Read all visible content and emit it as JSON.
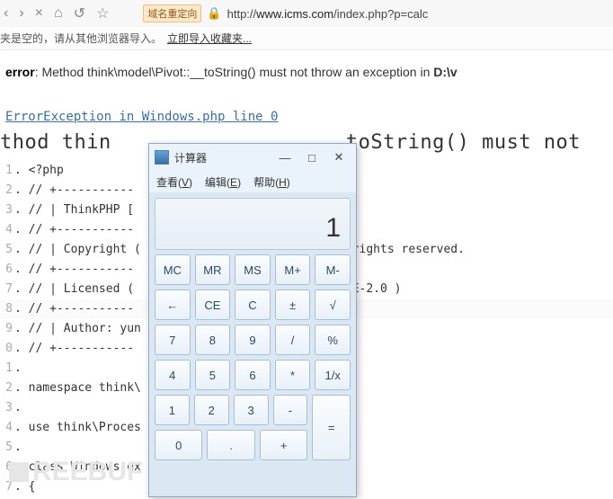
{
  "toolbar": {
    "redirect_label": "域名重定向",
    "url_prefix": "http://",
    "url_host": "www.icms.com",
    "url_path": "/index.php?p=calc"
  },
  "bookmark_bar": {
    "empty_msg": "夹是空的，请从其他浏览器导入。",
    "import_link": "立即导入收藏夹..."
  },
  "page": {
    "fatal_prefix": "error",
    "fatal_msg": ": Method think\\model\\Pivot::__toString() must not throw an exception in ",
    "fatal_path": "D:\\v",
    "exc_link": "ErrorException in Windows.php line 0",
    "big_left": "thod thin",
    "big_right": "toString() must not",
    "code_lines": [
      {
        "n": "1",
        "t": "<?php"
      },
      {
        "n": "2",
        "t": "// +-----------"
      },
      {
        "n": "3",
        "t": "// | ThinkPHP ["
      },
      {
        "n": "4",
        "t": "// +-----------"
      },
      {
        "n": "5",
        "t": "// | Copyright ("
      },
      {
        "n": "5r",
        "t": " rights reserved."
      },
      {
        "n": "6",
        "t": "// +-----------"
      },
      {
        "n": "7",
        "t": "// | Licensed ("
      },
      {
        "n": "7r",
        "t": "NSE-2.0 )"
      },
      {
        "n": "8",
        "t": "// +-----------"
      },
      {
        "n": "9",
        "t": "// | Author: yun"
      },
      {
        "n": "0",
        "t": "// +-----------"
      },
      {
        "n": "1b",
        "t": ""
      },
      {
        "n": "2b",
        "t": "namespace think\\"
      },
      {
        "n": "3b",
        "t": ""
      },
      {
        "n": "4b",
        "t": "use think\\Proces"
      },
      {
        "n": "5b",
        "t": ""
      },
      {
        "n": "6b",
        "t": "class Windows ex"
      },
      {
        "n": "7b",
        "t": "{"
      }
    ]
  },
  "watermark": "REEBUF",
  "calc": {
    "title": "计算器",
    "menu": {
      "view": "查看",
      "v": "V",
      "edit": "编辑",
      "e": "E",
      "help": "帮助",
      "h": "H"
    },
    "display": "1",
    "rows": [
      [
        "MC",
        "MR",
        "MS",
        "M+",
        "M-"
      ],
      [
        "←",
        "CE",
        "C",
        "±",
        "√"
      ],
      [
        "7",
        "8",
        "9",
        "/",
        "%"
      ],
      [
        "4",
        "5",
        "6",
        "*",
        "1/x"
      ]
    ],
    "last": {
      "r1": [
        "1",
        "2",
        "3",
        "-"
      ],
      "r2wide": "0",
      "r2dot": ".",
      "r2plus": "+",
      "eq": "="
    }
  }
}
